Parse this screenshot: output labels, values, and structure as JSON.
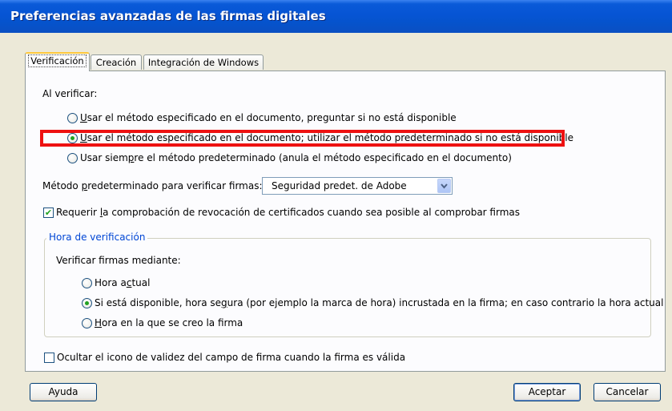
{
  "window": {
    "title": "Preferencias avanzadas de las firmas digitales"
  },
  "tabs": [
    {
      "label": "Verificación",
      "active": true
    },
    {
      "label": "Creación",
      "active": false
    },
    {
      "label": "Integración de Windows",
      "active": false
    }
  ],
  "verify": {
    "heading": "Al verificar:",
    "options": [
      {
        "pre": "U",
        "rest": "sar el método especificado en el documento, preguntar si no está disponible",
        "checked": false
      },
      {
        "pre": "U",
        "rest": "sar el método especificado en el documento; utilizar el método predeterminado si no está disponible",
        "checked": true
      },
      {
        "pre": "Usar siem",
        "mid": "p",
        "rest": "re el método predeterminado (anula el método especificado en el documento)",
        "checked": false
      }
    ]
  },
  "default_method": {
    "label_pre": "Método ",
    "label_u": "p",
    "label_rest": "redeterminado para verificar firmas:",
    "selected": "Seguridad predet. de Adobe"
  },
  "revocation": {
    "pre": "Requerir ",
    "u": "l",
    "rest": "a comprobación de revocación de certificados cuando sea posible al comprobar firmas",
    "checked": true
  },
  "time_group": {
    "legend": "Hora de verificación",
    "prompt": "Verificar firmas mediante:",
    "options": [
      {
        "pre": "Hora a",
        "u": "c",
        "rest": "tual",
        "checked": false
      },
      {
        "pre": "Si está disponible, hora se",
        "u": "g",
        "rest": "ura (por ejemplo la marca de hora) incrustada en la firma; en caso contrario la hora actual",
        "checked": true
      },
      {
        "pre": "",
        "u": "H",
        "rest": "ora en la que se creo la firma",
        "checked": false
      }
    ]
  },
  "hide_icon": {
    "label": "Ocultar el icono de validez del campo de firma cuando la firma es válida",
    "checked": false
  },
  "buttons": {
    "help": "Ayuda",
    "ok": "Aceptar",
    "cancel": "Cancelar"
  }
}
